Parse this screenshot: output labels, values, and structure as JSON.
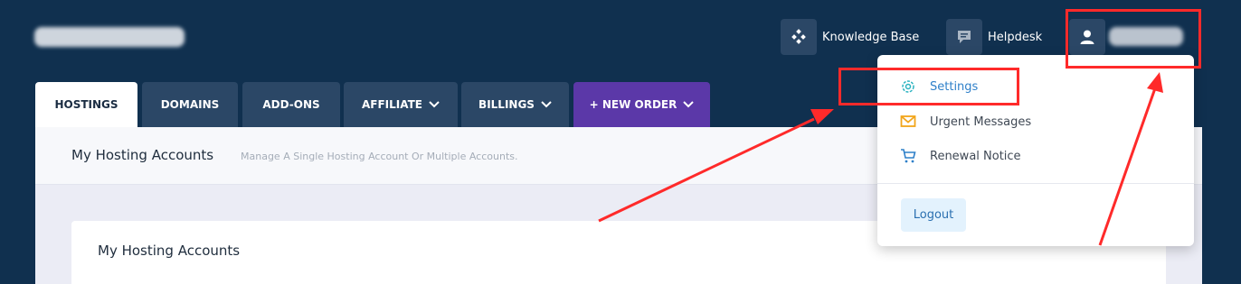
{
  "header": {
    "nav": [
      {
        "label": "Knowledge Base",
        "icon": "knowledge-base-icon"
      },
      {
        "label": "Helpdesk",
        "icon": "helpdesk-icon"
      }
    ],
    "user_icon": "user-icon"
  },
  "tabs": [
    {
      "label": "HOSTINGS",
      "active": true
    },
    {
      "label": "DOMAINS"
    },
    {
      "label": "ADD-ONS"
    },
    {
      "label": "AFFILIATE",
      "has_chevron": true
    },
    {
      "label": "BILLINGS",
      "has_chevron": true
    },
    {
      "label": "+ NEW ORDER",
      "has_chevron": true
    }
  ],
  "panel": {
    "title": "My Hosting Accounts",
    "subtitle": "Manage A Single Hosting Account Or Multiple Accounts.",
    "card_title": "My Hosting Accounts"
  },
  "dropdown": {
    "items": [
      {
        "label": "Settings",
        "icon": "gear-icon"
      },
      {
        "label": "Urgent Messages",
        "icon": "envelope-icon"
      },
      {
        "label": "Renewal Notice",
        "icon": "cart-icon"
      }
    ],
    "logout_label": "Logout"
  },
  "colors": {
    "header_bg": "#10304f",
    "tab_bg": "#2b4766",
    "order_tab_bg": "#5b38a8",
    "highlight": "#ff2a2a",
    "settings_accent": "#2f80c9"
  }
}
